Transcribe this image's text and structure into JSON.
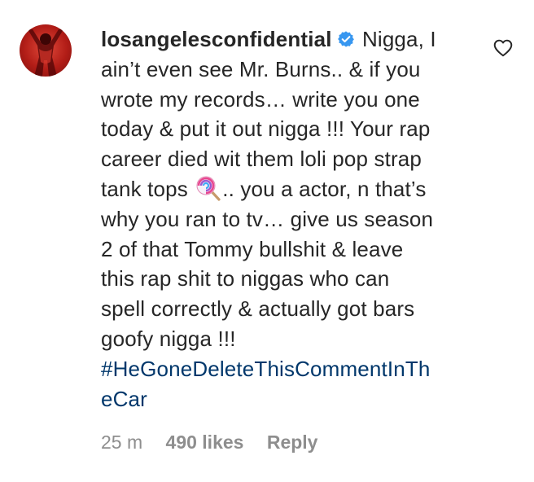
{
  "comment": {
    "username": "losangelesconfidential",
    "verified_icon": "verified-badge-icon",
    "lines": [
      "Nigga, I",
      "ain’t even see Mr. Burns.. & if you",
      "wrote my records… write you one",
      "today & put it out nigga !!! Your rap",
      "career died wit them loli pop strap",
      "tank tops",
      ".. you a actor, n that’s",
      "why you ran to tv… give us season",
      "2 of that Tommy bullshit & leave",
      "this rap shit to niggas who can",
      "spell correctly & actually got bars",
      "goofy nigga !!!"
    ],
    "hashtag_lines": [
      "#HeGoneDeleteThisCommentInTh",
      "eCar"
    ],
    "emoji": "lollipop-emoji-icon",
    "hashtag_color": "#00376b"
  },
  "meta": {
    "time": "25 m",
    "likes": "490 likes",
    "reply": "Reply"
  },
  "actions": {
    "like_icon": "heart-outline-icon"
  }
}
